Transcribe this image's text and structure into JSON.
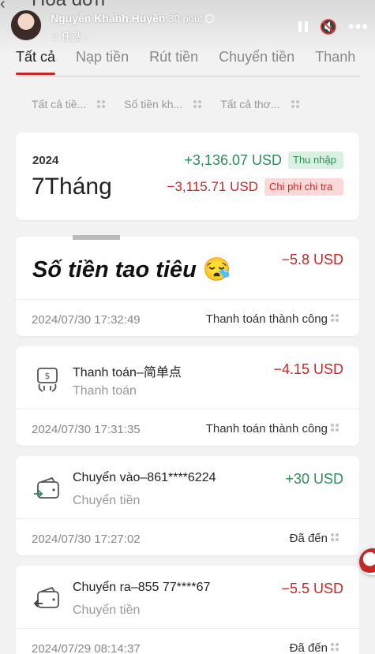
{
  "story": {
    "user_name": "Nguyễn Khánh Huyền",
    "time": "30 phút",
    "music": "♫ 任然",
    "chevron": "›",
    "mute_glyph": "🔇",
    "more_glyph": "•••"
  },
  "page": {
    "title_ghost": "Hoá đơn"
  },
  "tabs": [
    {
      "label": "Tất cả",
      "active": true
    },
    {
      "label": "Nạp tiền"
    },
    {
      "label": "Rút tiền"
    },
    {
      "label": "Chuyển tiền"
    },
    {
      "label": "Thanh"
    }
  ],
  "filters": [
    {
      "label": "Tất cả tiề..."
    },
    {
      "label": "Số tiền kh..."
    },
    {
      "label": "Tất cả thơ..."
    }
  ],
  "summary": {
    "year": "2024",
    "month": "7Tháng",
    "income": "+3,136.07 USD",
    "income_badge": "Thu nhập",
    "expense": "−3,115.71 USD",
    "expense_badge": "Chi phí chi tra"
  },
  "sticker": {
    "text": "Số tiền tao tiêu",
    "emoji": "😪"
  },
  "transactions": [
    {
      "title": "",
      "subtitle": "",
      "amount": "−5.8 USD",
      "date": "2024/07/30  17:32:49",
      "status": "Thanh toán thành công",
      "kind": "negative",
      "icon": "payment-icon"
    },
    {
      "title": "Thanh toán–简单点",
      "subtitle": "Thanh toán",
      "amount": "−4.15 USD",
      "date": "2024/07/30  17:31:35",
      "status": "Thanh toán thành công",
      "kind": "negative",
      "icon": "payment-icon"
    },
    {
      "title": "Chuyển vào–861****6224",
      "subtitle": "Chuyển tiền",
      "amount": "+30 USD",
      "date": "2024/07/30  17:27:02",
      "status": "Đã đến",
      "kind": "positive",
      "icon": "wallet-in-icon"
    },
    {
      "title": "Chuyển ra–855 77****67",
      "subtitle": "Chuyển tiền",
      "amount": "−5.5 USD",
      "date": "2024/07/29  08:14:37",
      "status": "Đã đến",
      "kind": "negative",
      "icon": "wallet-out-icon"
    }
  ],
  "colors": {
    "accent": "#c62828",
    "positive": "#2e8b57",
    "background": "#f2f2f2"
  }
}
